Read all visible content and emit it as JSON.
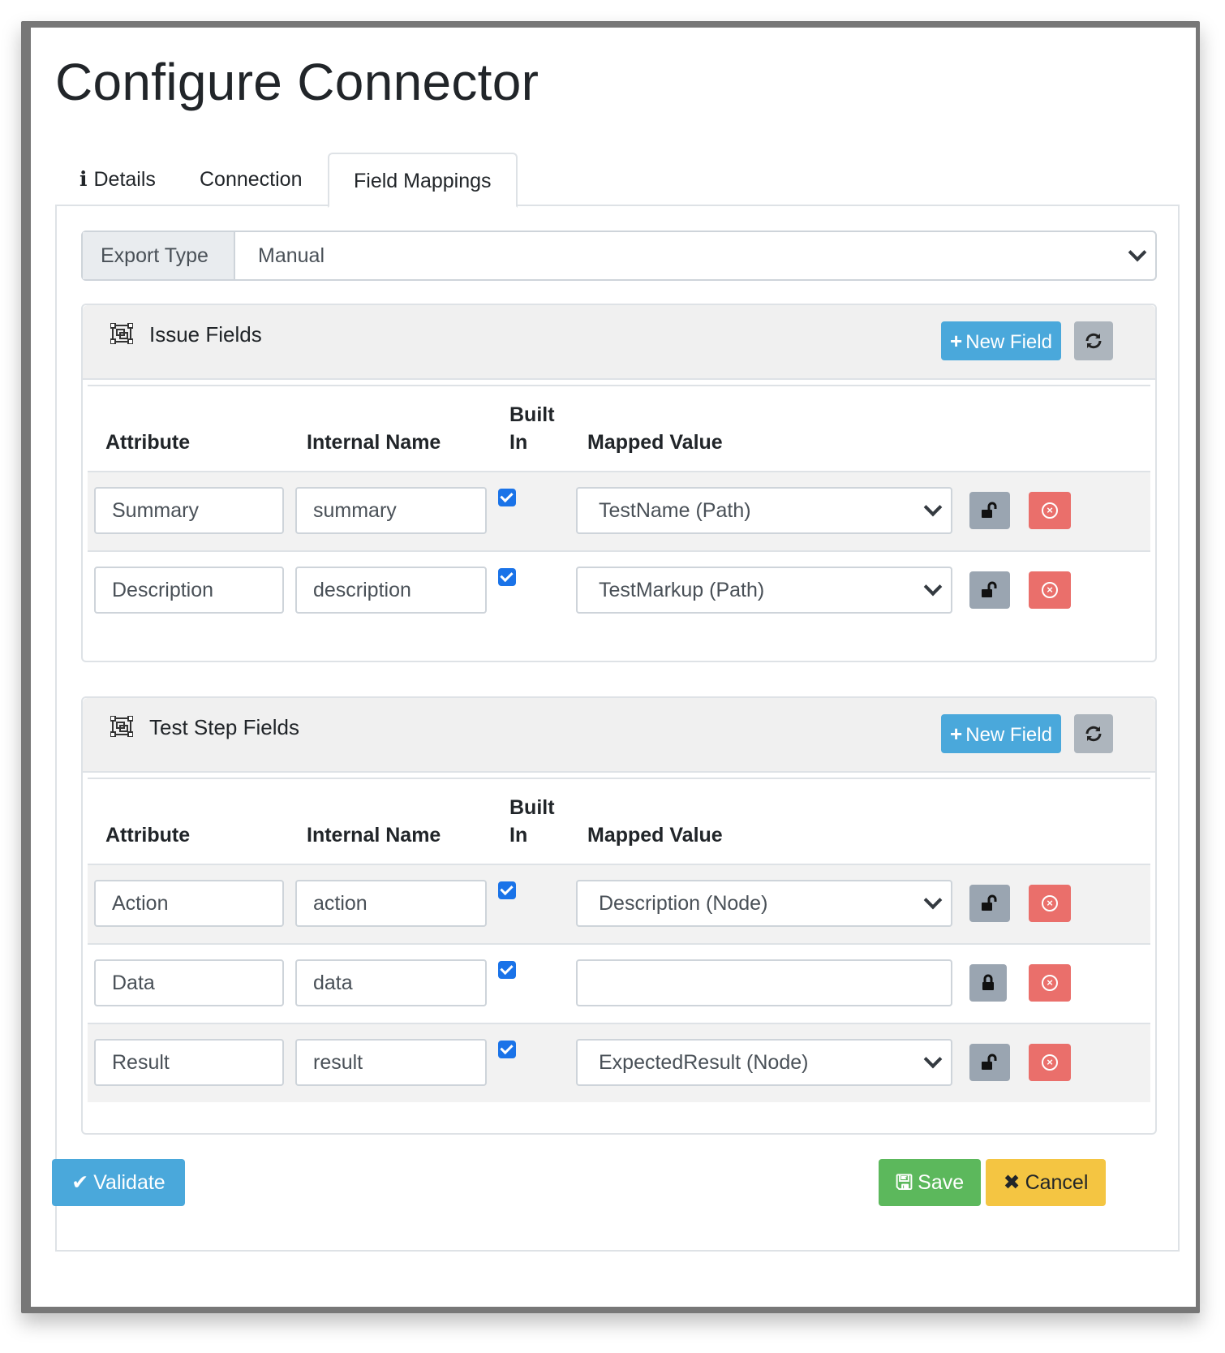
{
  "modal": {
    "title": "Configure Connector",
    "tabs": [
      {
        "label": "Details",
        "icon": "info-icon"
      },
      {
        "label": "Connection"
      },
      {
        "label": "Field Mappings",
        "active": true
      }
    ]
  },
  "export": {
    "label": "Export Type",
    "value": "Manual"
  },
  "columns": {
    "attribute": "Attribute",
    "internal": "Internal Name",
    "built_in_1": "Built",
    "built_in_2": "In",
    "mapped": "Mapped Value"
  },
  "issue_fields": {
    "title": "Issue Fields",
    "new_button": "New Field",
    "rows": [
      {
        "attribute": "Summary",
        "internal": "summary",
        "built_in": true,
        "mapped": "TestName (Path)",
        "lock": "unlocked"
      },
      {
        "attribute": "Description",
        "internal": "description",
        "built_in": true,
        "mapped": "TestMarkup (Path)",
        "lock": "unlocked"
      }
    ]
  },
  "step_fields": {
    "title": "Test Step Fields",
    "new_button": "New Field",
    "rows": [
      {
        "attribute": "Action",
        "internal": "action",
        "built_in": true,
        "mapped": "Description (Node)",
        "lock": "unlocked"
      },
      {
        "attribute": "Data",
        "internal": "data",
        "built_in": true,
        "mapped": "",
        "lock": "locked"
      },
      {
        "attribute": "Result",
        "internal": "result",
        "built_in": true,
        "mapped": "ExpectedResult (Node)",
        "lock": "unlocked"
      }
    ]
  },
  "footer": {
    "validate": "Validate",
    "save": "Save",
    "cancel": "Cancel"
  },
  "colors": {
    "primary": "#4aa8db",
    "success": "#5cb85c",
    "warning": "#f4c542",
    "danger": "#ea6f6b",
    "secondary": "#adb5bd"
  }
}
